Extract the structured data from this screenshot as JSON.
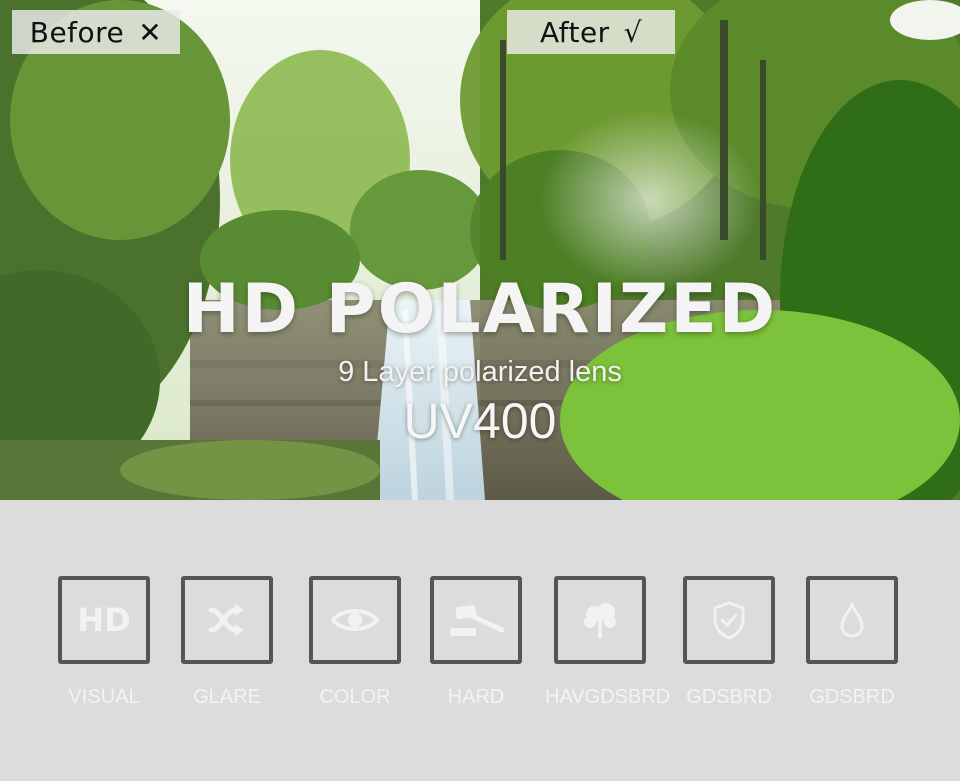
{
  "comparison": {
    "before_label": "Before",
    "before_symbol": "✕",
    "after_label": "After",
    "after_symbol": "√"
  },
  "hero": {
    "headline": "HD POLARIZED",
    "subtitle": "9 Layer polarized lens",
    "rating": "UV400"
  },
  "features": [
    {
      "label": "VISUAL",
      "icon": "hd-icon",
      "icon_text": "HD"
    },
    {
      "label": "GLARE",
      "icon": "glare-shuffle-icon"
    },
    {
      "label": "COLOR",
      "icon": "eye-icon"
    },
    {
      "label": "HARD",
      "icon": "hammer-icon"
    },
    {
      "label": "HAVGDSBRD",
      "icon": "tree-icon"
    },
    {
      "label": "GDSBRD",
      "icon": "shield-check-icon"
    },
    {
      "label": "GDSBRD",
      "icon": "water-drop-icon"
    }
  ],
  "colors": {
    "panel_background": "#dcdcdc",
    "icon_border": "#555555",
    "icon_fill": "#f2f2f2",
    "foliage": "#5a8a2e"
  }
}
